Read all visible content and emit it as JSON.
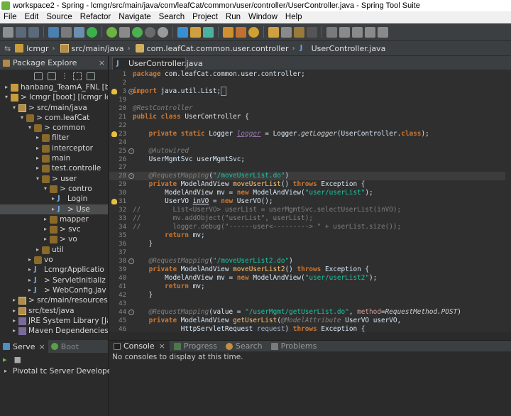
{
  "window": {
    "title": "workspace2 - Spring - lcmgr/src/main/java/com/leafCat/common/user/controller/UserController.java - Spring Tool Suite"
  },
  "menu": [
    "File",
    "Edit",
    "Source",
    "Refactor",
    "Navigate",
    "Search",
    "Project",
    "Run",
    "Window",
    "Help"
  ],
  "breadcrumb": [
    "lcmgr",
    "src/main/java",
    "com.leafCat.common.user.controller",
    "UserController.java"
  ],
  "explorer": {
    "tab_label": "Package Explore",
    "items": [
      {
        "label": "hanbang_TeamA_FNL [boo",
        "arrow": "▸",
        "icon": "project-icon"
      },
      {
        "label": "> lcmgr [boot] [lcmgr leaf",
        "arrow": "▾",
        "icon": "project-icon"
      },
      {
        "label": "> src/main/java",
        "arrow": "▾",
        "icon": "source-folder-icon"
      },
      {
        "label": "> com.leafCat",
        "arrow": "▾",
        "icon": "package-icon"
      },
      {
        "label": "> common",
        "arrow": "▾",
        "icon": "package-icon"
      },
      {
        "label": "filter",
        "arrow": "▸",
        "icon": "package-icon"
      },
      {
        "label": "interceptor",
        "arrow": "▸",
        "icon": "package-icon"
      },
      {
        "label": "main",
        "arrow": "▸",
        "icon": "package-icon"
      },
      {
        "label": "test.controlle",
        "arrow": "▸",
        "icon": "package-icon"
      },
      {
        "label": "> user",
        "arrow": "▾",
        "icon": "package-icon"
      },
      {
        "label": "> contro",
        "arrow": "▾",
        "icon": "package-icon"
      },
      {
        "label": "Login",
        "arrow": "▸",
        "icon": "java-file-icon"
      },
      {
        "label": "> Use",
        "arrow": "▸",
        "icon": "java-file-icon"
      },
      {
        "label": "mapper",
        "arrow": "▸",
        "icon": "package-icon"
      },
      {
        "label": "> svc",
        "arrow": "▸",
        "icon": "package-icon"
      },
      {
        "label": "> vo",
        "arrow": "▸",
        "icon": "package-icon"
      },
      {
        "label": "util",
        "arrow": "▸",
        "icon": "package-icon"
      },
      {
        "label": "vo",
        "arrow": "▸",
        "icon": "package-icon"
      },
      {
        "label": "LcmgrApplicatio",
        "arrow": "▸",
        "icon": "java-file-icon"
      },
      {
        "label": "> ServletInitializ",
        "arrow": "▸",
        "icon": "java-file-icon"
      },
      {
        "label": "> WebConfig.jav",
        "arrow": "▸",
        "icon": "java-file-icon"
      },
      {
        "label": "> src/main/resources",
        "arrow": "▸",
        "icon": "source-folder-icon"
      },
      {
        "label": "src/test/java",
        "arrow": "▸",
        "icon": "source-folder-icon"
      },
      {
        "label": "JRE System Library [Jav",
        "arrow": "▸",
        "icon": "library-icon"
      },
      {
        "label": "Maven Dependencies",
        "arrow": "▸",
        "icon": "library-icon"
      }
    ]
  },
  "editor": {
    "tab_label": "UserController.java",
    "lines": [
      {
        "n": "1",
        "html": "<span class='kw'>package</span> com.leafCat.common.user.controller;"
      },
      {
        "n": "2",
        "html": ""
      },
      {
        "n": "3",
        "html": "<span class='kw'>import</span> java.util.List;<span style='border:1px solid #999'>&nbsp;</span>",
        "marker": "bulb",
        "fold": "+"
      },
      {
        "n": "19",
        "html": ""
      },
      {
        "n": "20",
        "html": "<span class='an'>@RestController</span>"
      },
      {
        "n": "21",
        "html": "<span class='kw'>public class</span> <span class='ty'>UserController</span> {"
      },
      {
        "n": "22",
        "html": ""
      },
      {
        "n": "23",
        "html": "    <span class='kw'>private static</span> Logger <span class='fld'>logger</span> = Logger.<span class='it'>getLogger</span>(UserController.<span class='kw'>class</span>);",
        "marker": "bulb"
      },
      {
        "n": "24",
        "html": ""
      },
      {
        "n": "25",
        "html": "    <span class='an'>@Autowired</span>",
        "fold": "-"
      },
      {
        "n": "26",
        "html": "    UserMgmtSvc userMgmtSvc;"
      },
      {
        "n": "27",
        "html": ""
      },
      {
        "n": "28",
        "html": "    <span class='an'>@RequestMapping</span>(<span class='st'>\"/moveUserList.do\"</span>)",
        "fold": "-",
        "hl": true
      },
      {
        "n": "29",
        "html": "    <span class='kw'>private</span> ModelAndView <span class='mth'>moveUserList</span>() <span class='kw'>throws</span> Exception {"
      },
      {
        "n": "30",
        "html": "        ModelAndView mv = <span class='kw'>new</span> ModelAndView(<span class='st'>\"user/userList\"</span>);"
      },
      {
        "n": "31",
        "html": "        UserVO <span style='text-decoration:underline'>inVO</span> = <span class='kw'>new</span> UserVO();",
        "marker": "bulb"
      },
      {
        "n": "32",
        "html": "<span class='cm'>//        List&lt;UserVO&gt; userList = userMgmtSvc.selectUserList(inVO);</span>"
      },
      {
        "n": "33",
        "html": "<span class='cm'>//        mv.addObject(\"userList\", userList);</span>"
      },
      {
        "n": "34",
        "html": "<span class='cm'>//        logger.debug(\"------user&lt;---------&gt; \" + userList.size());</span>"
      },
      {
        "n": "35",
        "html": "        <span class='kw'>return</span> mv;"
      },
      {
        "n": "36",
        "html": "    }"
      },
      {
        "n": "37",
        "html": ""
      },
      {
        "n": "38",
        "html": "    <span class='an'>@RequestMapping</span>(<span class='st'>\"/moveUserList2.do\"</span>)",
        "fold": "-"
      },
      {
        "n": "39",
        "html": "    <span class='kw'>private</span> ModelAndView <span class='mth'>moveUserList2</span>() <span class='kw'>throws</span> Exception {"
      },
      {
        "n": "40",
        "html": "        ModelAndView mv = <span class='kw'>new</span> ModelAndView(<span class='st'>\"user/userList2\"</span>);"
      },
      {
        "n": "41",
        "html": "        <span class='kw'>return</span> mv;"
      },
      {
        "n": "42",
        "html": "    }"
      },
      {
        "n": "43",
        "html": ""
      },
      {
        "n": "44",
        "html": "    <span class='an'>@RequestMapping</span>(value = <span class='st'>\"/userMgmt/getUserList.do\"</span>, <span style='color:#d6a0a0'>method</span>=<span class='it'>RequestMethod.POST</span>)",
        "fold": "-"
      },
      {
        "n": "45",
        "html": "    <span class='kw'>private</span> ModelAndView <span class='mth'>getUserList</span>(<span class='an'>@ModelAttribute</span> UserVO userVO,"
      },
      {
        "n": "46",
        "html": "            HttpServletRequest <span style='color:#9fb0c8'>request</span>) <span class='kw'>throws</span> Exception {"
      }
    ]
  },
  "bottom_left": {
    "tabs": [
      "Serve",
      "Boot"
    ],
    "server": "Pivotal tc Server Developer"
  },
  "bottom_right": {
    "tabs": [
      "Console",
      "Progress",
      "Search",
      "Problems"
    ],
    "message": "No consoles to display at this time."
  },
  "colors": {
    "background": "#2b2b2b",
    "keyword": "#cc7832",
    "string": "#17c6a3",
    "annotation": "#808080",
    "spring_green": "#6db33f"
  }
}
